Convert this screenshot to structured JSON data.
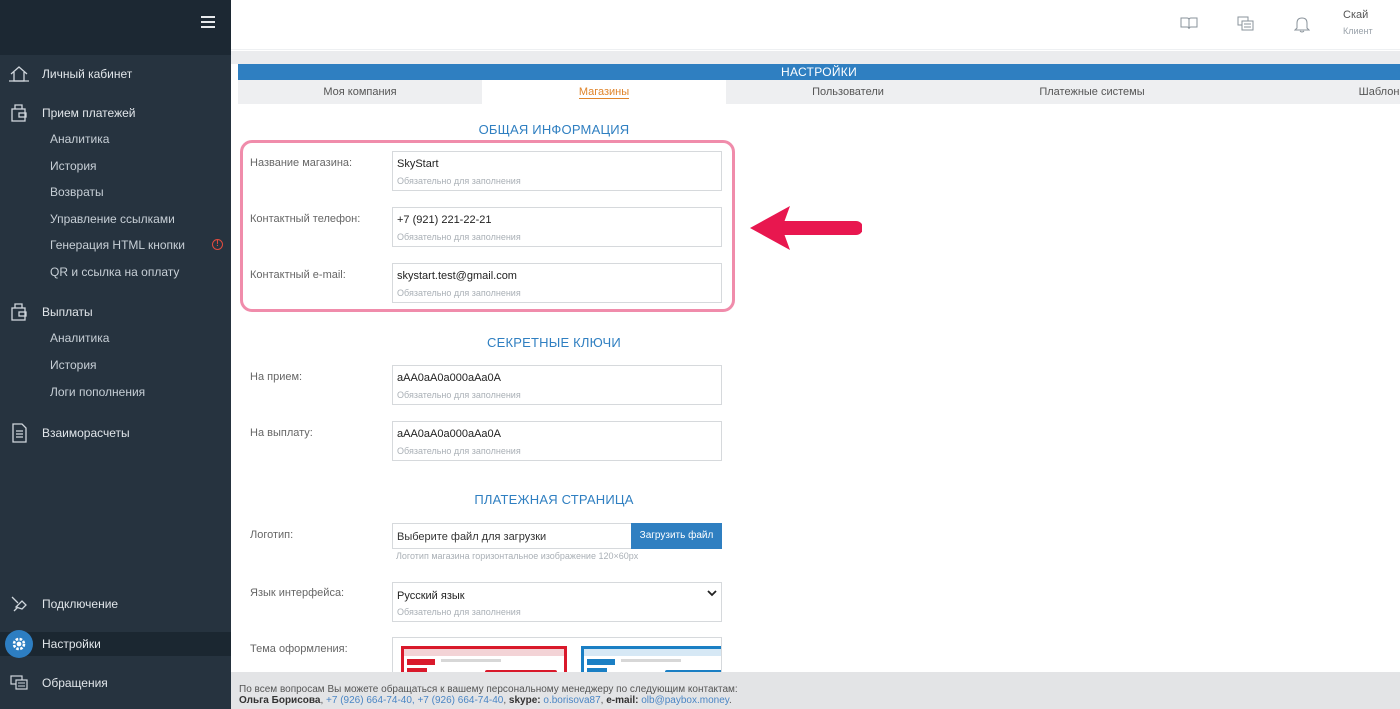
{
  "sidebar": {
    "items": [
      {
        "label": "Личный кабинет",
        "icon": "home-icon"
      },
      {
        "label": "Прием платежей",
        "icon": "wallet-icon",
        "children": [
          "Аналитика",
          "История",
          "Возвраты",
          "Управление ссылками",
          "Генерация HTML кнопки",
          "QR и ссылка на оплату"
        ]
      },
      {
        "label": "Выплаты",
        "icon": "wallet-icon",
        "children": [
          "Аналитика",
          "История",
          "Логи пополнения"
        ]
      },
      {
        "label": "Взаиморасчеты",
        "icon": "document-icon"
      },
      {
        "label": "Подключение",
        "icon": "plug-icon"
      },
      {
        "label": "Настройки",
        "icon": "gear-icon"
      },
      {
        "label": "Обращения",
        "icon": "chat-icon"
      }
    ],
    "warning_badge": "!"
  },
  "header": {
    "user_name": "Скай",
    "user_role": "Клиент"
  },
  "panel": {
    "title": "НАСТРОЙКИ",
    "tabs": [
      "Моя компания",
      "Магазины",
      "Пользователи",
      "Платежные системы",
      "Шаблоны"
    ],
    "active_tab": "Магазины"
  },
  "general": {
    "title": "ОБЩАЯ ИНФОРМАЦИЯ",
    "fields": [
      {
        "label": "Название магазина:",
        "value": "SkyStart",
        "hint": "Обязательно для заполнения"
      },
      {
        "label": "Контактный телефон:",
        "value": "+7 (921) 221-22-21",
        "hint": "Обязательно для заполнения"
      },
      {
        "label": "Контактный e-mail:",
        "value": "skystart.test@gmail.com",
        "hint": "Обязательно для заполнения"
      }
    ]
  },
  "secret": {
    "title": "СЕКРЕТНЫЕ КЛЮЧИ",
    "fields": [
      {
        "label": "На прием:",
        "value": "aAA0aA0a000aAa0A",
        "hint": "Обязательно для заполнения"
      },
      {
        "label": "На выплату:",
        "value": "aAA0aA0a000aAa0A",
        "hint": "Обязательно для заполнения"
      }
    ]
  },
  "payment_page": {
    "title": "ПЛАТЕЖНАЯ СТРАНИЦА",
    "logo_label": "Логотип:",
    "logo_value": "Выберите файл для загрузки",
    "upload_button": "Загрузить файл",
    "logo_hint": "Логотип магазина горизонтальное изображение 120×60px",
    "language_label": "Язык интерфейса:",
    "language_value": "Русский язык",
    "language_hint": "Обязательно для заполнения",
    "theme_label": "Тема оформления:",
    "theme_colors": [
      "#d9192b",
      "#1a7fc4"
    ]
  },
  "footer": {
    "line1": "По всем вопросам Вы можете обращаться к вашему персональному менеджеру по следующим контактам:",
    "manager": "Ольга Борисова",
    "phones": "+7 (926) 664-74-40, +7 (926) 664-74-40",
    "skype_label": "skype:",
    "skype": "o.borisova87",
    "email_label": "e-mail:",
    "email": "olb@paybox.money"
  },
  "colors": {
    "sidebar_bg": "#26333f",
    "accent": "#2f7fc1",
    "active_tab": "#e0842a",
    "highlight": "#f08cab",
    "arrow": "#e8174f"
  }
}
